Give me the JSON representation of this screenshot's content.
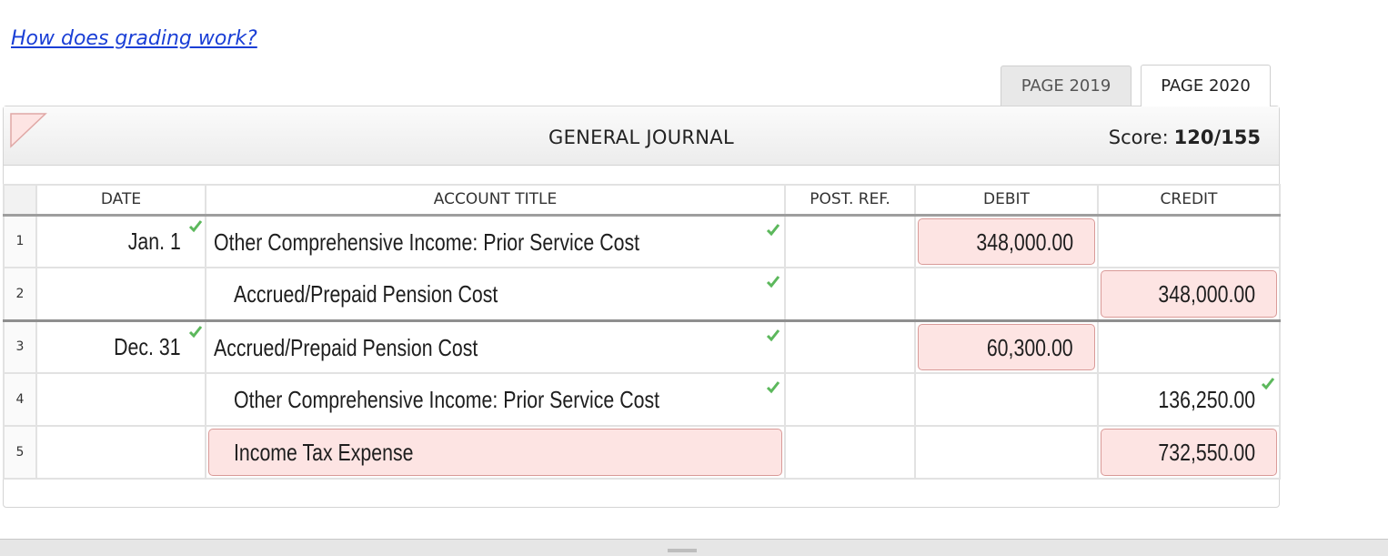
{
  "help_link": "How does grading work?",
  "tabs": [
    {
      "label": "PAGE 2019",
      "active": false
    },
    {
      "label": "PAGE 2020",
      "active": true
    }
  ],
  "journal": {
    "title": "GENERAL JOURNAL",
    "score_label": "Score:",
    "score_value": "120/155",
    "headers": {
      "date": "DATE",
      "account_title": "ACCOUNT TITLE",
      "post_ref": "POST. REF.",
      "debit": "DEBIT",
      "credit": "CREDIT"
    },
    "rows": [
      {
        "num": "1",
        "date": "Jan. 1",
        "account": "Other Comprehensive Income: Prior Service Cost",
        "debit": "348,000.00",
        "credit": ""
      },
      {
        "num": "2",
        "date": "",
        "account": "Accrued/Prepaid Pension Cost",
        "debit": "",
        "credit": "348,000.00"
      },
      {
        "num": "3",
        "date": "Dec. 31",
        "account": "Accrued/Prepaid Pension Cost",
        "debit": "60,300.00",
        "credit": ""
      },
      {
        "num": "4",
        "date": "",
        "account": "Other Comprehensive Income: Prior Service Cost",
        "debit": "",
        "credit": "136,250.00"
      },
      {
        "num": "5",
        "date": "",
        "account": "Income Tax Expense",
        "debit": "",
        "credit": "732,550.00"
      }
    ]
  },
  "colors": {
    "link": "#1a3fd6",
    "check": "#5cb85c",
    "error_fill": "#fde4e3",
    "error_border": "#d99a98"
  },
  "icons": [
    "flag-icon",
    "check-icon",
    "grip-icon"
  ]
}
